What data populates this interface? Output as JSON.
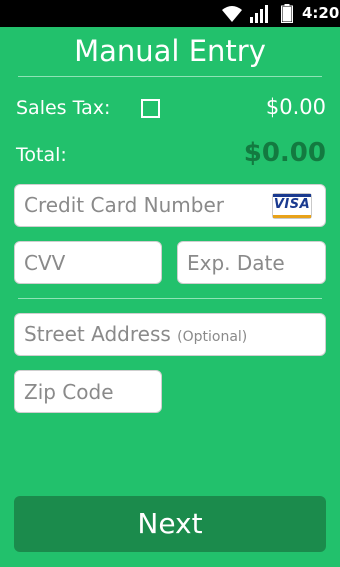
{
  "status_bar": {
    "time": "4:20"
  },
  "header": {
    "title": "Manual Entry"
  },
  "sales_tax": {
    "label": "Sales Tax:",
    "checked": false,
    "amount": "$0.00"
  },
  "total": {
    "label": "Total:",
    "amount": "$0.00"
  },
  "form": {
    "credit_card": {
      "placeholder": "Credit Card Number",
      "card_brand": "VISA"
    },
    "cvv": {
      "placeholder": "CVV"
    },
    "exp_date": {
      "placeholder": "Exp. Date"
    },
    "street": {
      "placeholder": "Street Address",
      "optional_hint": "(Optional)"
    },
    "zip": {
      "placeholder": "Zip Code"
    }
  },
  "actions": {
    "next_label": "Next"
  },
  "colors": {
    "background": "#22c16c",
    "total_amount": "#137a40",
    "button": "#1b8b4c",
    "divider": "#8fe3b6"
  }
}
